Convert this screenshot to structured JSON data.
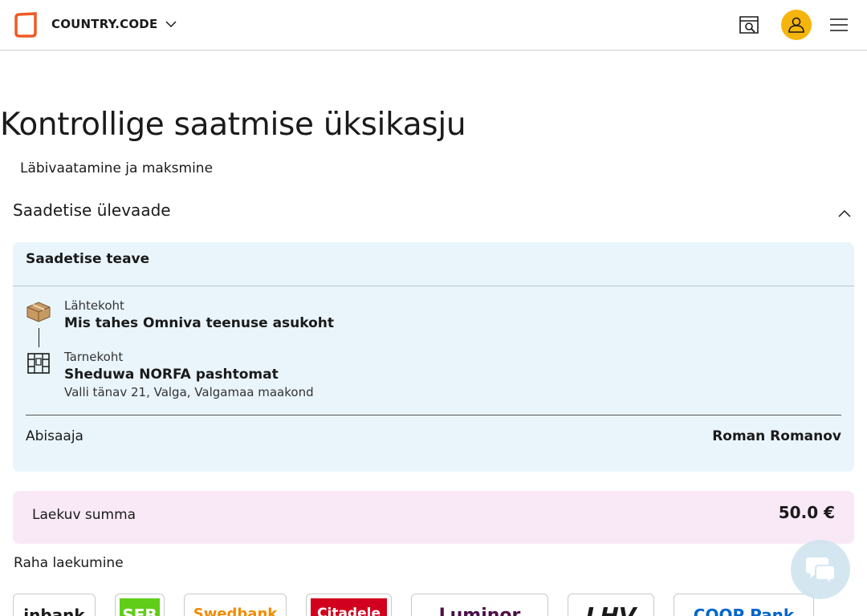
{
  "header": {
    "country_label": "COUNTRY.CODE"
  },
  "page": {
    "title": "Kontrollige saatmise üksikasju",
    "step_label": "Läbivaatamine ja maksmine"
  },
  "overview": {
    "title": "Saadetise ülevaade",
    "info_title": "Saadetise teave",
    "from_label": "Lähtekoht",
    "from_value": "Mis tahes Omniva teenuse asukoht",
    "to_label": "Tarnekoht",
    "to_value": "Sheduwa NORFA pashtomat",
    "to_address": "Valli tänav 21, Valga, Valgamaa maakond",
    "recipient_label": "Abisaaja",
    "recipient_value": "Roman Romanov"
  },
  "amount": {
    "label": "Laekuv summa",
    "value": "50.0 €"
  },
  "payment": {
    "title": "Raha laekumine",
    "banks": [
      {
        "text": "inbank",
        "color": "#1a1a1a"
      },
      {
        "text": "SEB",
        "color": "#ffffff"
      },
      {
        "text": "Swedbank",
        "color": "#f28c00"
      },
      {
        "text": "Citadele",
        "color": "#ffffff"
      },
      {
        "text": "Luminor",
        "color": "#4b1049"
      },
      {
        "text": "LHV",
        "color": "#1a1a1a"
      },
      {
        "text": "COOP Pank",
        "color": "#0066cc"
      }
    ]
  },
  "colors": {
    "brand_orange": "#ee5a24",
    "avatar_yellow": "#f5b50d",
    "info_card_bg": "#e9f5fb",
    "amount_card_bg": "#f9e9f7",
    "seb_green": "#60cd18",
    "citadele_red": "#d2001e"
  }
}
